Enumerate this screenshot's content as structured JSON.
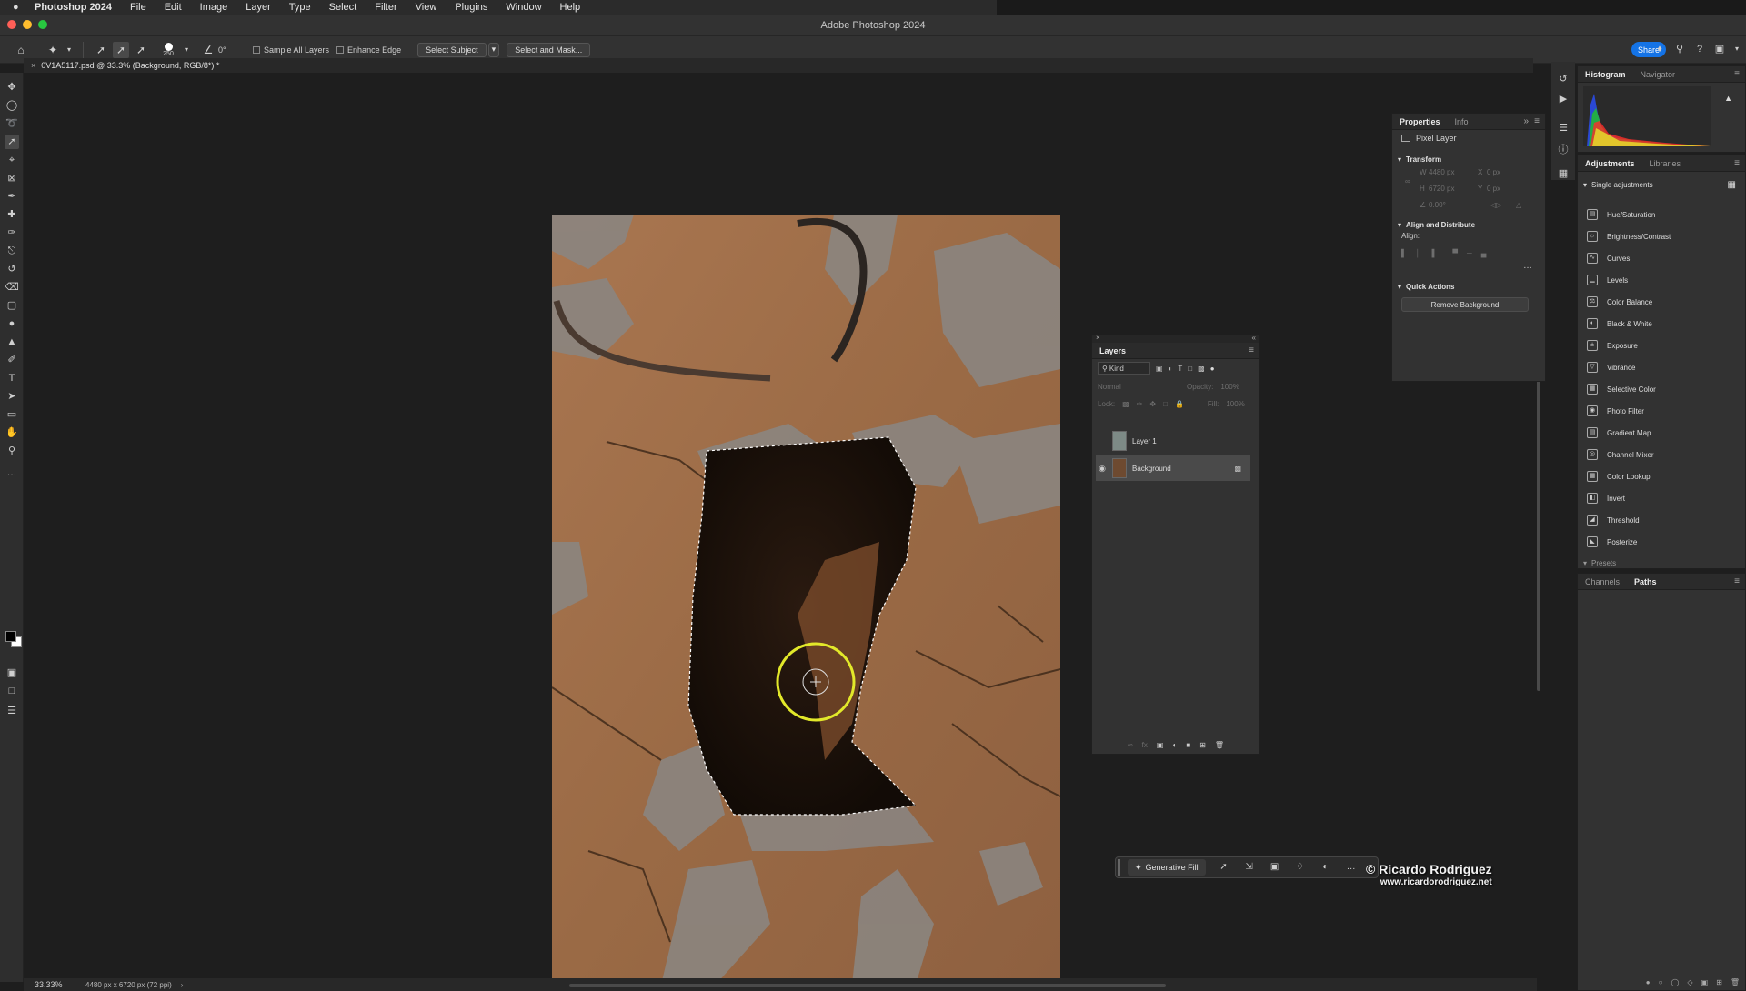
{
  "menubar": {
    "items": [
      "Photoshop 2024",
      "File",
      "Edit",
      "Image",
      "Layer",
      "Type",
      "Select",
      "Filter",
      "View",
      "Plugins",
      "Window",
      "Help"
    ]
  },
  "window": {
    "title": "Adobe Photoshop 2024"
  },
  "options": {
    "brush_size": "250",
    "angle": "0°",
    "sample_all_layers": "Sample All Layers",
    "enhance_edge": "Enhance Edge",
    "select_subject": "Select Subject",
    "select_and_mask": "Select and Mask...",
    "share": "Share"
  },
  "document": {
    "tab_title": "0V1A5117.psd @ 33.3% (Background, RGB/8*) *"
  },
  "status": {
    "zoom": "33.33%",
    "dimensions": "4480 px x 6720 px (72 ppi)"
  },
  "properties": {
    "tabs": [
      "Properties",
      "Info"
    ],
    "layer_type": "Pixel Layer",
    "transform": "Transform",
    "fields": {
      "w": "W",
      "h": "H",
      "x": "X",
      "y": "Y",
      "w_val": "4480 px",
      "h_val": "6720 px",
      "x_val": "0 px",
      "y_val": "0 px",
      "angle_val": "0.00°"
    },
    "align_distribute": "Align and Distribute",
    "align_label": "Align:",
    "quick_actions": "Quick Actions",
    "remove_bg": "Remove Background"
  },
  "layers": {
    "title": "Layers",
    "kind": "Kind",
    "blend_mode": "Normal",
    "opacity_label": "Opacity:",
    "opacity": "100%",
    "lock_label": "Lock:",
    "fill_label": "Fill:",
    "fill": "100%",
    "items": [
      {
        "name": "Layer 1",
        "visible": false
      },
      {
        "name": "Background",
        "visible": true,
        "locked": true
      }
    ]
  },
  "histogram": {
    "tabs": [
      "Histogram",
      "Navigator"
    ]
  },
  "adjustments": {
    "tabs": [
      "Adjustments",
      "Libraries"
    ],
    "section": "Single adjustments",
    "items": [
      "Hue/Saturation",
      "Brightness/Contrast",
      "Curves",
      "Levels",
      "Color Balance",
      "Black & White",
      "Exposure",
      "Vibrance",
      "Selective Color",
      "Photo Filter",
      "Gradient Map",
      "Channel Mixer",
      "Color Lookup",
      "Invert",
      "Threshold",
      "Posterize"
    ],
    "presets": "Presets"
  },
  "channels": {
    "tabs": [
      "Channels",
      "Paths"
    ]
  },
  "contextual": {
    "generative_fill": "Generative Fill"
  },
  "watermark": {
    "name": "© Ricardo Rodriguez",
    "url": "www.ricardorodriguez.net"
  },
  "colors": {
    "accent": "#1473e6",
    "panel": "#323232",
    "bg": "#1e1e1e",
    "brush_ring": "#e2e82a"
  }
}
